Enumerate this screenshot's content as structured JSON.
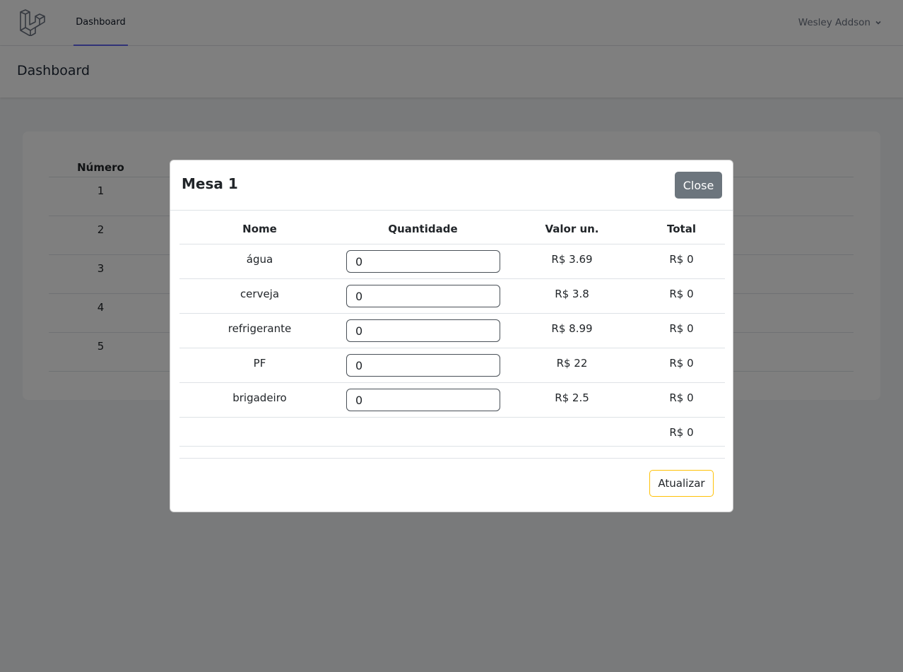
{
  "nav": {
    "logo_icon": "laravel-logo-icon",
    "dashboard_link": "Dashboard",
    "user_name": "Wesley Addson",
    "user_menu_icon": "chevron-down-icon"
  },
  "header": {
    "title": "Dashboard"
  },
  "background_table": {
    "columns": [
      "Número"
    ],
    "rows": [
      "1",
      "2",
      "3",
      "4",
      "5"
    ]
  },
  "modal": {
    "title": "Mesa 1",
    "close_label": "Close",
    "columns": [
      "Nome",
      "Quantidade",
      "Valor un.",
      "Total"
    ],
    "items": [
      {
        "name": "água",
        "quantity": "0",
        "unit_price": "R$ 3.69",
        "total": "R$ 0"
      },
      {
        "name": "cerveja",
        "quantity": "0",
        "unit_price": "R$ 3.8",
        "total": "R$ 0"
      },
      {
        "name": "refrigerante",
        "quantity": "0",
        "unit_price": "R$ 8.99",
        "total": "R$ 0"
      },
      {
        "name": "PF",
        "quantity": "0",
        "unit_price": "R$ 22",
        "total": "R$ 0"
      },
      {
        "name": "brigadeiro",
        "quantity": "0",
        "unit_price": "R$ 2.5",
        "total": "R$ 0"
      }
    ],
    "grand_total": "R$ 0",
    "update_label": "Atualizar"
  },
  "colors": {
    "accent_nav": "#6366f1",
    "close_button": "#6c757d",
    "update_border": "#ffc107",
    "overlay": "rgba(0,0,0,0.5)"
  }
}
